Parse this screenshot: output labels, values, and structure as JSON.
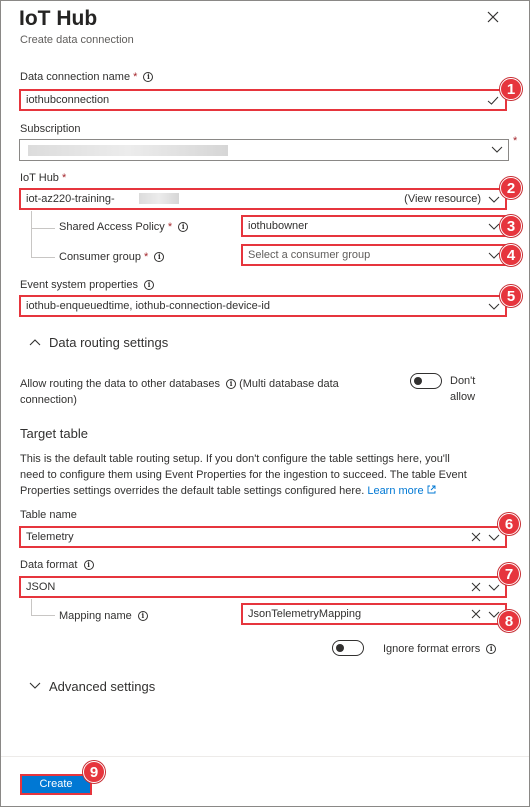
{
  "header": {
    "title": "IoT Hub",
    "subtitle": "Create data connection"
  },
  "data_connection": {
    "label": "Data connection name",
    "required": "*",
    "value": "iothubconnection"
  },
  "subscription": {
    "label": "Subscription",
    "required": "*"
  },
  "iot_hub": {
    "label": "IoT Hub",
    "required": "*",
    "value": "iot-az220-training-",
    "view_resource": "(View resource)"
  },
  "shared_access_policy": {
    "label": "Shared Access Policy",
    "required": "*",
    "value": "iothubowner"
  },
  "consumer_group": {
    "label": "Consumer group",
    "required": "*",
    "placeholder": "Select a consumer group"
  },
  "event_system_properties": {
    "label": "Event system properties",
    "value": "iothub-enqueuedtime, iothub-connection-device-id"
  },
  "data_routing": {
    "header": "Data routing settings",
    "allow_label_line1": "Allow routing the data to other databases",
    "allow_label_suffix": "(Multi database data",
    "allow_label_line2": "connection)",
    "toggle_label_line1": "Don't",
    "toggle_label_line2": "allow"
  },
  "target_table": {
    "header": "Target table",
    "description_line1": "This is the default table routing setup. If you don't configure the table settings here, you'll",
    "description_line2": "need to configure them using Event Properties for the ingestion to succeed. The table Event",
    "description_line3": "Properties settings overrides the default table settings configured here.",
    "learn_more": "Learn more"
  },
  "table_name": {
    "label": "Table name",
    "value": "Telemetry"
  },
  "data_format": {
    "label": "Data format",
    "value": "JSON"
  },
  "mapping_name": {
    "label": "Mapping name",
    "value": "JsonTelemetryMapping"
  },
  "ignore_format_errors": {
    "label": "Ignore format errors"
  },
  "advanced": {
    "header": "Advanced settings"
  },
  "footer": {
    "create_label": "Create"
  },
  "badges": [
    "1",
    "2",
    "3",
    "4",
    "5",
    "6",
    "7",
    "8",
    "9"
  ],
  "colors": {
    "highlight_red": "#e6353d",
    "primary_blue": "#0078d4",
    "required_red": "#a4262c"
  },
  "icons": {
    "close": "close-icon",
    "chevron": "chevron-down-icon",
    "info": "info-icon",
    "clear": "clear-icon",
    "expand": "chevron-up-icon",
    "external": "external-link-icon"
  }
}
